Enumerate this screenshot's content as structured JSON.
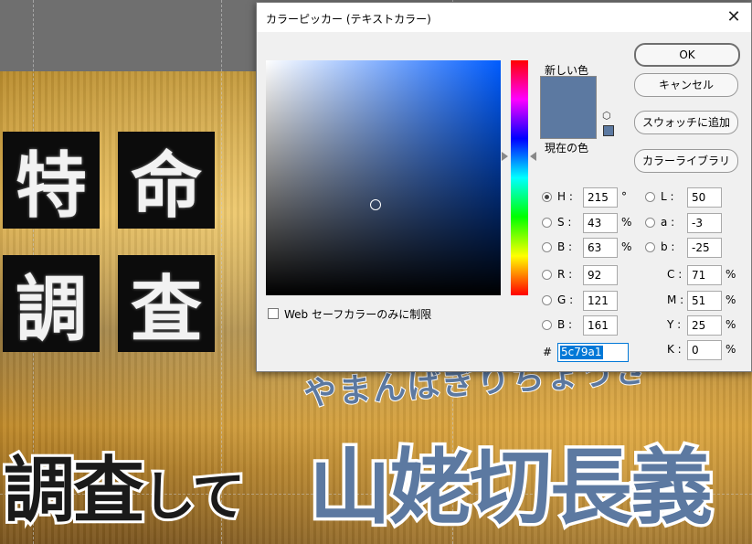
{
  "background": {
    "kanji": [
      "特",
      "命",
      "調",
      "査"
    ],
    "furigana": "やまんばぎりちょうぎ",
    "caption_left": "調査",
    "caption_left_small": "して",
    "caption_main": "山姥切長義"
  },
  "dialog": {
    "title": "カラーピッカー (テキストカラー)",
    "close_symbol": "✕",
    "new_label": "新しい色",
    "current_label": "現在の色",
    "buttons": {
      "ok": "OK",
      "cancel": "キャンセル",
      "add_swatch": "スウォッチに追加",
      "color_libraries": "カラーライブラリ"
    },
    "websafe_label": "Web セーフカラーのみに制限",
    "hsb": {
      "h": {
        "label": "H :",
        "value": "215",
        "unit": "°",
        "selected": true
      },
      "s": {
        "label": "S :",
        "value": "43",
        "unit": "%"
      },
      "b": {
        "label": "B :",
        "value": "63",
        "unit": "%"
      }
    },
    "rgb": {
      "r": {
        "label": "R :",
        "value": "92"
      },
      "g": {
        "label": "G :",
        "value": "121"
      },
      "b": {
        "label": "B :",
        "value": "161"
      }
    },
    "lab": {
      "l": {
        "label": "L :",
        "value": "50"
      },
      "a": {
        "label": "a :",
        "value": "-3"
      },
      "b": {
        "label": "b :",
        "value": "-25"
      }
    },
    "cmyk": {
      "c": {
        "label": "C :",
        "value": "71",
        "unit": "%"
      },
      "m": {
        "label": "M :",
        "value": "51",
        "unit": "%"
      },
      "y": {
        "label": "Y :",
        "value": "25",
        "unit": "%"
      },
      "k": {
        "label": "K :",
        "value": "0",
        "unit": "%"
      }
    },
    "hex_label": "#",
    "hex_value": "5c79a1",
    "colors": {
      "selected": "#5c79a1",
      "hue_base": "#005cff"
    }
  }
}
